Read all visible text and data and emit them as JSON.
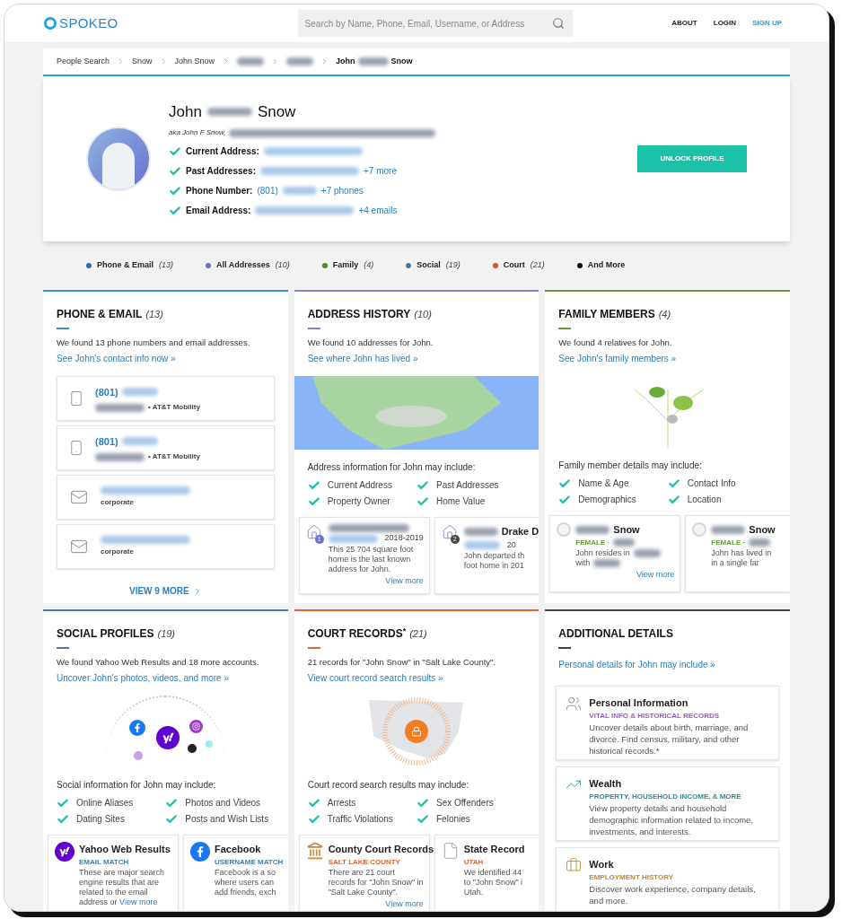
{
  "header": {
    "logo": "SPOKEO",
    "search": {
      "placeholder": "Search by Name, Phone, Email, Username, or Address"
    },
    "nav": [
      {
        "label": "ABOUT",
        "kind": "plain"
      },
      {
        "label": "LOGIN",
        "kind": "plain"
      },
      {
        "label": "SIGN UP",
        "kind": "accent"
      }
    ]
  },
  "breadcrumb": [
    {
      "kind": "link",
      "label": "People Search"
    },
    {
      "kind": "link",
      "label": "Snow"
    },
    {
      "kind": "link",
      "label": "John Snow"
    },
    {
      "kind": "redacted"
    },
    {
      "kind": "redacted"
    },
    {
      "kind": "current",
      "first": "John",
      "last": "Snow"
    }
  ],
  "profile": {
    "first": "John",
    "last": "Snow",
    "aka": "aka John F Snow,",
    "facts": [
      {
        "label": "Current Address:"
      },
      {
        "label": "Past Addresses:",
        "more": "+7 more"
      },
      {
        "label": "Phone Number:",
        "value": "(801)",
        "more": "+7 phones"
      },
      {
        "label": "Email Address:",
        "more": "+4 emails"
      }
    ],
    "button": "UNLOCK PROFILE"
  },
  "legend": [
    {
      "label": "Phone & Email",
      "count": "(13)",
      "color": "#1f6fb5"
    },
    {
      "label": "All Addresses",
      "count": "(10)",
      "color": "#6a6fd0"
    },
    {
      "label": "Family",
      "count": "(4)",
      "color": "#4f8a2a"
    },
    {
      "label": "Social",
      "count": "(19)",
      "color": "#4a7aa0"
    },
    {
      "label": "Court",
      "count": "(21)",
      "color": "#d9541e"
    },
    {
      "label": "And More",
      "color": "#111111"
    }
  ],
  "sections": [
    {
      "kind": "contacts",
      "title": "PHONE & EMAIL",
      "count": "(13)",
      "color": "#3f8ed0",
      "intro": "We found 13 phone numbers and email addresses.",
      "link": "See John's contact info now »",
      "items": [
        {
          "kind": "phone",
          "value": "(801)",
          "sub": "• AT&T Mobility"
        },
        {
          "kind": "phone",
          "value": "(801)",
          "sub": "• AT&T Mobility"
        },
        {
          "kind": "email",
          "sub": "corporate"
        },
        {
          "kind": "email",
          "sub": "corporate"
        }
      ],
      "more": "VIEW 9 MORE"
    },
    {
      "kind": "addresses",
      "title": "ADDRESS HISTORY",
      "count": "(10)",
      "color": "#8080d0",
      "intro": "We found 10 addresses for John.",
      "link": "See where John has lived »",
      "includes_title": "Address information for John may include:",
      "includes": [
        "Current Address",
        "Past Addresses",
        "Property Owner",
        "Home Value"
      ],
      "cards": [
        {
          "badge": "1",
          "year": "2018-2019",
          "lines": [
            "This 25 704 square foot home is the last known address for John."
          ],
          "link": "View more"
        },
        {
          "badge": "2",
          "title": "Drake D",
          "year": "20",
          "lines": [
            "John departed th",
            "foot home in 201"
          ]
        }
      ]
    },
    {
      "kind": "family",
      "title": "FAMILY MEMBERS",
      "count": "(4)",
      "color": "#6a9a3a",
      "intro": "We found 4 relatives for John.",
      "link": "See John's family members »",
      "includes_title": "Family member details may include:",
      "includes": [
        "Name & Age",
        "Contact Info",
        "Demographics",
        "Location"
      ],
      "cards": [
        {
          "title": "Snow",
          "tag": "FEMALE ·",
          "lines": [
            "John resides in",
            "with"
          ],
          "link": "View more"
        },
        {
          "title": "Snow",
          "tag": "FEMALE ·",
          "lines": [
            "John has lived in",
            "in a single far"
          ]
        }
      ]
    },
    {
      "kind": "social",
      "title": "SOCIAL PROFILES",
      "count": "(19)",
      "color": "#4a7aa5",
      "intro": "We found Yahoo Web Results and 18 more accounts.",
      "link": "Uncover John's photos, videos, and more »",
      "includes_title": "Social information for John may include:",
      "includes": [
        "Online Aliases",
        "Photos and Videos",
        "Dating Sites",
        "Posts and Wish Lists"
      ],
      "cards": [
        {
          "kind": "yahoo",
          "title": "Yahoo Web Results",
          "tag": "EMAIL MATCH",
          "lines": [
            "These are major search engine results that are related to the email address or"
          ],
          "link": "View more"
        },
        {
          "kind": "facebook",
          "title": "Facebook",
          "tag": "USERNAME MATCH",
          "lines": [
            "Facebook is a so",
            "where users can",
            "add friends, exch"
          ]
        }
      ]
    },
    {
      "kind": "court",
      "title": "COURT RECORDS$^{*}$",
      "count": "(21)",
      "color": "#e0662e",
      "intro": "21 records for \"John Snow\" in \"Salt Lake County\".",
      "link": "View court record search results »",
      "includes_title": "Court record search results may include:",
      "includes": [
        "Arrests",
        "Sex Offenders",
        "Traffic Violations",
        "Felonies"
      ],
      "cards": [
        {
          "kind": "courthouse",
          "title": "County Court Records",
          "tag": "SALT LAKE COUNTY",
          "lines": [
            "There are 21 court records for \"John Snow\" in \"Salt Lake County\"."
          ],
          "link": "View more"
        },
        {
          "kind": "state",
          "title": "State Record",
          "tag": "UTAH",
          "lines": [
            "We identified 44",
            "to \"John Snow\" i",
            "Utah."
          ]
        }
      ]
    },
    {
      "kind": "details",
      "title": "ADDITIONAL DETAILS",
      "color": "#444444",
      "link": "Personal details for John may include »",
      "items": [
        {
          "kind": "people",
          "title": "Personal Information",
          "tag": "VITAL INFO & HISTORICAL RECORDS",
          "color": "#9b59c9",
          "desc": "Uncover details about birth, marriage, and divorce. Find census, military, and other historical records.*"
        },
        {
          "kind": "chart",
          "title": "Wealth",
          "tag": "PROPERTY, HOUSEHOLD INCOME, & MORE",
          "color": "#2a8f8f",
          "desc": "View property details and household demographic information related to income, investments, and interests."
        },
        {
          "kind": "briefcase",
          "title": "Work",
          "tag": "EMPLOYMENT HISTORY",
          "color": "#c2892b",
          "desc": "Discover work experience, company details, and more."
        }
      ]
    }
  ]
}
